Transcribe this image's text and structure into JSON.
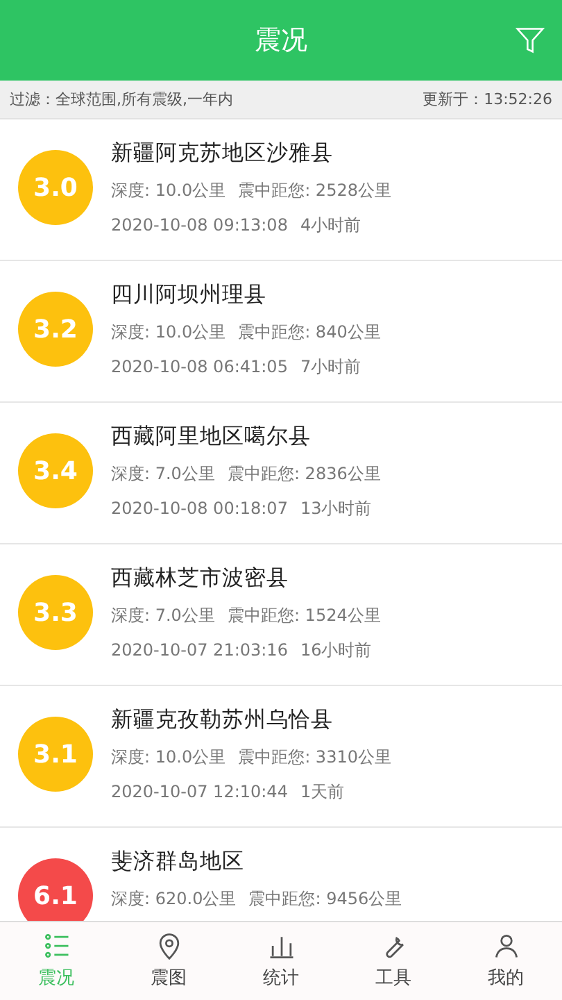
{
  "header": {
    "title": "震况"
  },
  "filter_bar": {
    "filter": "过滤：全球范围,所有震级,一年内",
    "updated": "更新于：13:52:26"
  },
  "quakes": [
    {
      "magnitude": "3.0",
      "color": "#fdc10e",
      "place": "新疆阿克苏地区沙雅县",
      "depth": "深度: 10.0公里",
      "distance": "震中距您: 2528公里",
      "time": "2020-10-08 09:13:08",
      "ago": "4小时前"
    },
    {
      "magnitude": "3.2",
      "color": "#fdc10e",
      "place": "四川阿坝州理县",
      "depth": "深度: 10.0公里",
      "distance": "震中距您: 840公里",
      "time": "2020-10-08 06:41:05",
      "ago": "7小时前"
    },
    {
      "magnitude": "3.4",
      "color": "#fdc10e",
      "place": "西藏阿里地区噶尔县",
      "depth": "深度: 7.0公里",
      "distance": "震中距您: 2836公里",
      "time": "2020-10-08 00:18:07",
      "ago": "13小时前"
    },
    {
      "magnitude": "3.3",
      "color": "#fdc10e",
      "place": "西藏林芝市波密县",
      "depth": "深度: 7.0公里",
      "distance": "震中距您: 1524公里",
      "time": "2020-10-07 21:03:16",
      "ago": "16小时前"
    },
    {
      "magnitude": "3.1",
      "color": "#fdc10e",
      "place": "新疆克孜勒苏州乌恰县",
      "depth": "深度: 10.0公里",
      "distance": "震中距您: 3310公里",
      "time": "2020-10-07 12:10:44",
      "ago": "1天前"
    },
    {
      "magnitude": "6.1",
      "color": "#f44a4a",
      "place": "斐济群岛地区",
      "depth": "深度: 620.0公里",
      "distance": "震中距您: 9456公里"
    }
  ],
  "tabs": [
    {
      "kind": "list",
      "label": "震况",
      "selected": true
    },
    {
      "kind": "pin",
      "label": "震图",
      "selected": false
    },
    {
      "kind": "chart",
      "label": "统计",
      "selected": false
    },
    {
      "kind": "tool",
      "label": "工具",
      "selected": false
    },
    {
      "kind": "person",
      "label": "我的",
      "selected": false
    }
  ]
}
